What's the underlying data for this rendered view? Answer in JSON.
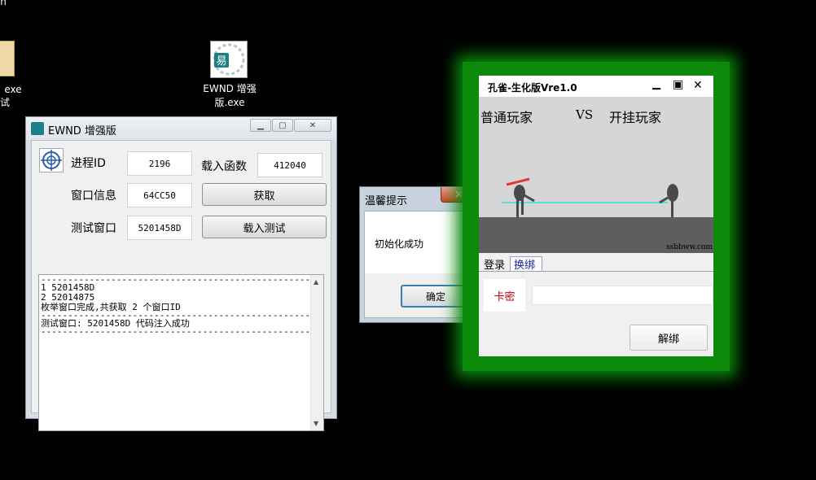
{
  "desktop": {
    "partial_label_top": "n",
    "left_icon_label_line1": "exe",
    "left_icon_label_line2": "试",
    "ewnd_icon_label_line1": "EWND 增强",
    "ewnd_icon_label_line2": "版.exe"
  },
  "ewnd": {
    "title": "EWND 增强版",
    "labels": {
      "pid": "进程ID",
      "load_func": "载入函数",
      "window_info": "窗口信息",
      "test_window": "测试窗口"
    },
    "values": {
      "pid": "2196",
      "load_func": "412040",
      "window_info": "64CC50",
      "test_window": "5201458D"
    },
    "buttons": {
      "get": "获取",
      "load_test": "载入测试"
    },
    "log_lines": [
      "------------------------------------------------------",
      "1 5201458D",
      "2 52014875",
      "枚举窗口完成,共获取 2 个窗口ID",
      "------------------------------------------------------",
      "测试窗口: 5201458D 代码注入成功",
      "------------------------------------------------------"
    ]
  },
  "dialog": {
    "title": "温馨提示",
    "close": "✕",
    "message": "初始化成功",
    "ok": "确定"
  },
  "game": {
    "title": "孔雀-生化版Vre1.0",
    "left_caption": "普通玩家",
    "vs": "VS",
    "right_caption": "开挂玩家",
    "watermark": "ssbbww.com",
    "tabs": [
      "登录",
      "换绑"
    ],
    "card_label": "卡密",
    "card_value": "",
    "unbind": "解绑"
  },
  "colors": {
    "glow": "#0b8a0b",
    "laser": "#35e0e0",
    "red_text": "#c00000",
    "tab_blue": "#1a2a9a"
  }
}
